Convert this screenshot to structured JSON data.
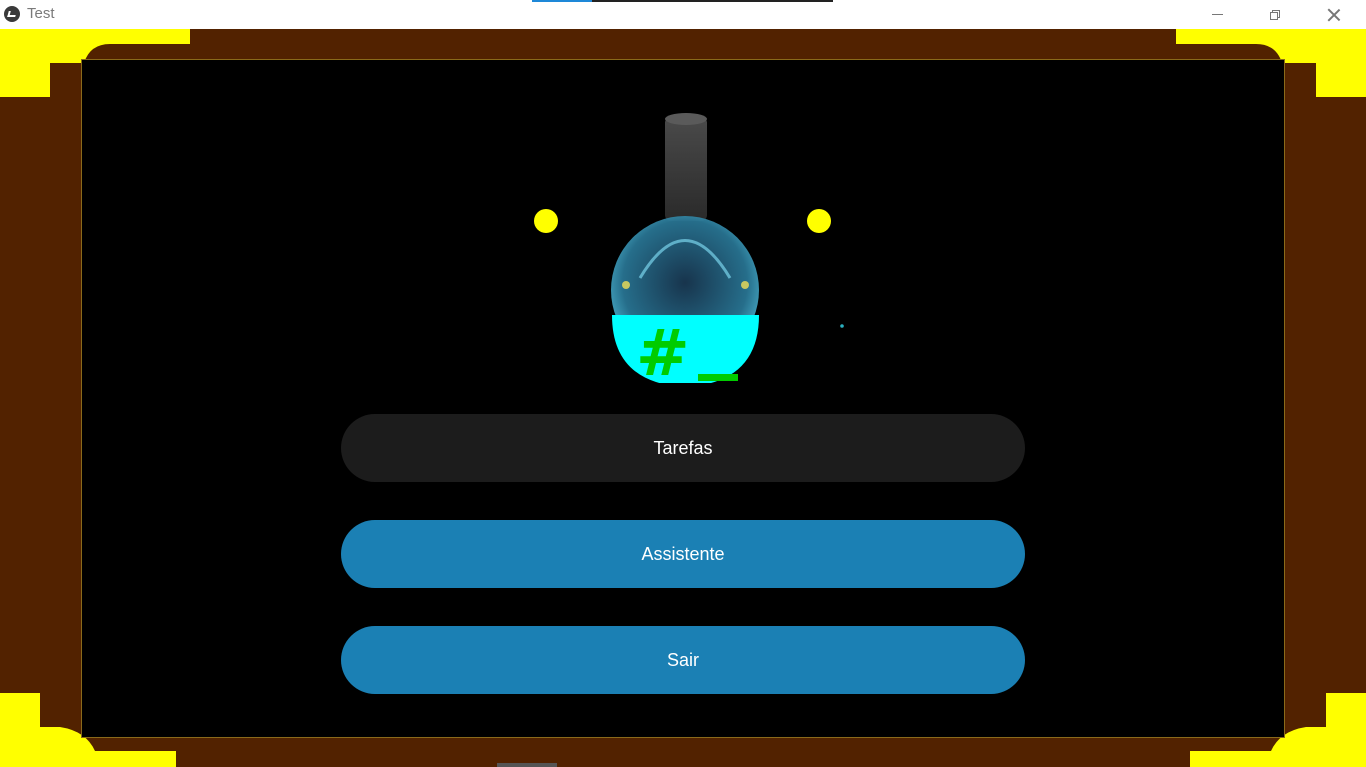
{
  "window": {
    "title": "Test",
    "icon": "kivy-app-icon",
    "controls": [
      "minimize-icon",
      "restore-icon",
      "close-icon"
    ]
  },
  "theme": {
    "frame_color": "#522200",
    "corner_color": "#ffff00",
    "background_color": "#000000",
    "primary_button_color": "#1b80b4",
    "secondary_button_color": "#1c1c1c",
    "liquid_color": "#00ffff",
    "symbol_color": "#00cc00"
  },
  "logo": {
    "icon": "flask-icon",
    "glyph": "#_"
  },
  "menu": {
    "tarefas_label": "Tarefas",
    "assistente_label": "Assistente",
    "sair_label": "Sair"
  }
}
